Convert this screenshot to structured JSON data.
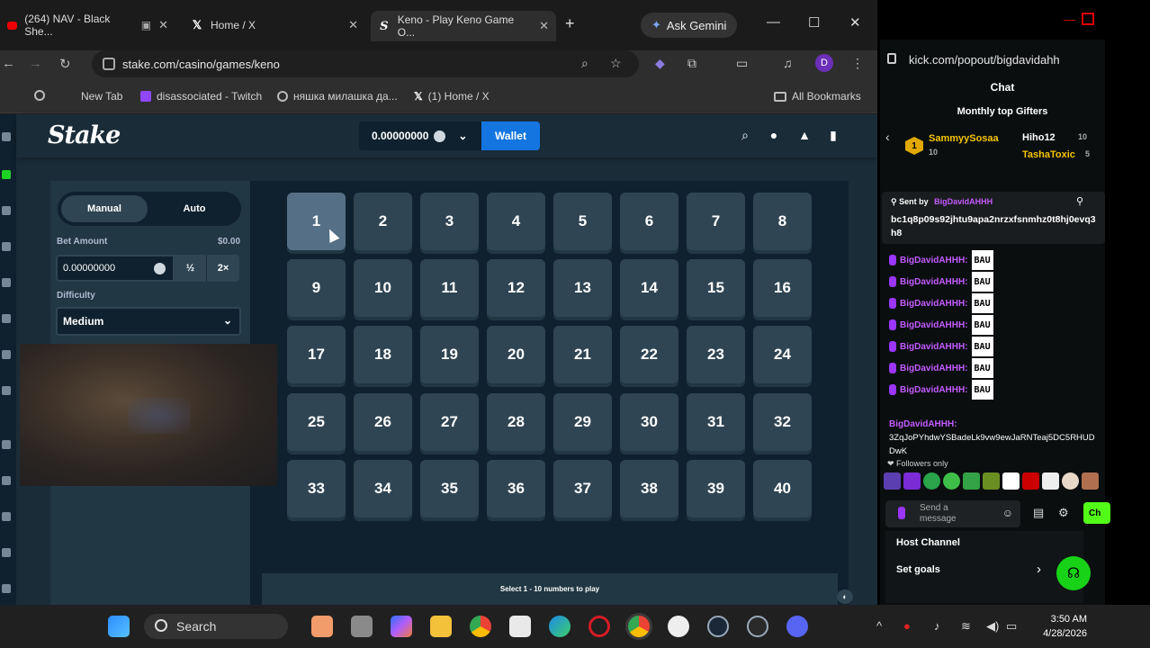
{
  "browser": {
    "tabs": [
      {
        "title": "(264) NAV - Black She...",
        "icon": "youtube-icon"
      },
      {
        "title": "Home / X",
        "icon": "x-icon"
      },
      {
        "title": "Keno - Play Keno Game O...",
        "icon": "stake-icon"
      }
    ],
    "ask_gemini": "Ask Gemini",
    "url": "stake.com/casino/games/keno",
    "profile_initial": "D",
    "bookmarks": [
      {
        "label": "New Tab"
      },
      {
        "label": "disassociated - Twitch"
      },
      {
        "label": "няшка милашка да..."
      },
      {
        "label": "(1) Home / X"
      }
    ],
    "all_bookmarks": "All Bookmarks"
  },
  "stake": {
    "logo": "Stake",
    "balance": "0.00000000",
    "wallet_label": "Wallet",
    "mode_manual": "Manual",
    "mode_auto": "Auto",
    "bet_amount_label": "Bet Amount",
    "bet_amount_usd": "$0.00",
    "bet_amount_value": "0.00000000",
    "half_label": "½",
    "double_label": "2×",
    "difficulty_label": "Difficulty",
    "difficulty_value": "Medium",
    "tiles": [
      "1",
      "2",
      "3",
      "4",
      "5",
      "6",
      "7",
      "8",
      "9",
      "10",
      "11",
      "12",
      "13",
      "14",
      "15",
      "16",
      "17",
      "18",
      "19",
      "20",
      "21",
      "22",
      "23",
      "24",
      "25",
      "26",
      "27",
      "28",
      "29",
      "30",
      "31",
      "32",
      "33",
      "34",
      "35",
      "36",
      "37",
      "38",
      "39",
      "40"
    ],
    "info_text": "Select 1 - 10 numbers to play"
  },
  "kick": {
    "url": "kick.com/popout/bigdavidahh",
    "title": "Chat",
    "gifters_title": "Monthly top Gifters",
    "gifters": [
      {
        "name": "SammyySosaa",
        "count": "10",
        "rank": "1"
      },
      {
        "name": "Hiho12",
        "count": "10"
      },
      {
        "name": "TashaToxic",
        "count": "5"
      }
    ],
    "pinned_by": "Sent by",
    "pinned_user": "BigDavidAHHH",
    "pinned_text": "bc1q8p09s92jhtu9apa2nrzxfsnmhz0t8hj0evq3h8",
    "messages": [
      {
        "user": "BigDavidAHHH:",
        "emote": "BAU"
      },
      {
        "user": "BigDavidAHHH:",
        "emote": "BAU"
      },
      {
        "user": "BigDavidAHHH:",
        "emote": "BAU"
      },
      {
        "user": "BigDavidAHHH:",
        "emote": "BAU"
      },
      {
        "user": "BigDavidAHHH:",
        "emote": "BAU"
      },
      {
        "user": "BigDavidAHHH:",
        "emote": "BAU"
      },
      {
        "user": "BigDavidAHHH:",
        "emote": "BAU"
      }
    ],
    "last_user": "BigDavidAHHH:",
    "last_text": "3ZqJoPYhdwYSBadeLk9vw9ewJaRNTeaj5DC5RHUDDwK",
    "followers_only": "Followers only",
    "send_placeholder": "Send a message",
    "chat_button": "Ch",
    "host_channel": "Host Channel",
    "set_goals": "Set goals"
  },
  "taskbar": {
    "search": "Search",
    "time": "3:50 AM",
    "date": "4/28/2026"
  }
}
